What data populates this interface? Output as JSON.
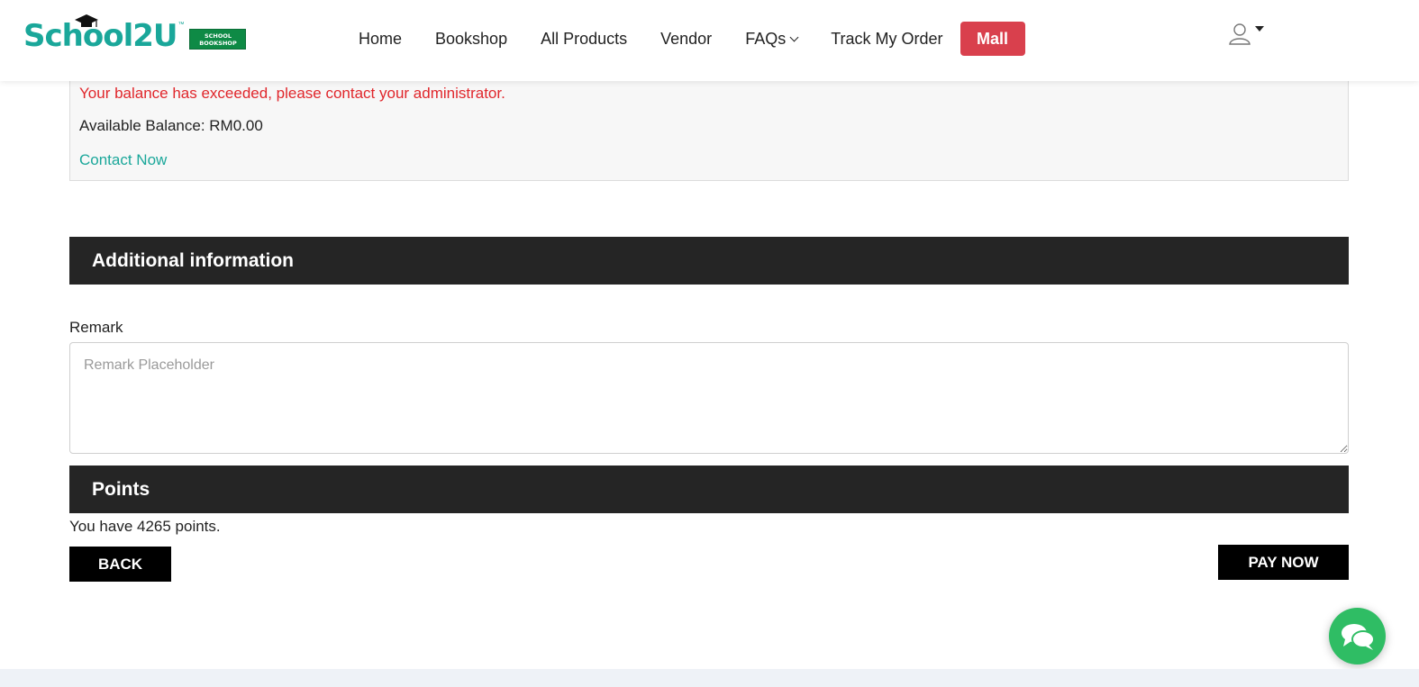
{
  "header": {
    "logo": {
      "wordmark": "School2U",
      "trademark": "™",
      "badge_line1": "SCHOOL",
      "badge_line2": "BOOKSHOP"
    },
    "nav": [
      {
        "label": "Home"
      },
      {
        "label": "Bookshop"
      },
      {
        "label": "All Products"
      },
      {
        "label": "Vendor"
      },
      {
        "label": "FAQs"
      },
      {
        "label": "Track My Order"
      }
    ],
    "mall_label": "Mall",
    "user_icon": "user-icon"
  },
  "balance": {
    "warning": "Your balance has exceeded, please contact your administrator.",
    "available": "Available Balance: RM0.00",
    "contact_link": "Contact Now"
  },
  "additional": {
    "title": "Additional information",
    "remark_label": "Remark",
    "remark_placeholder": "Remark Placeholder",
    "remark_value": ""
  },
  "points": {
    "title": "Points",
    "summary": "You have 4265 points."
  },
  "actions": {
    "back_label": "BACK",
    "pay_label": "PAY NOW"
  },
  "colors": {
    "brand_teal": "#1aa79a",
    "mall_red": "#d9404d",
    "warning_red": "#e0262b",
    "section_dark": "#252525",
    "chat_green": "#2fbd64"
  }
}
